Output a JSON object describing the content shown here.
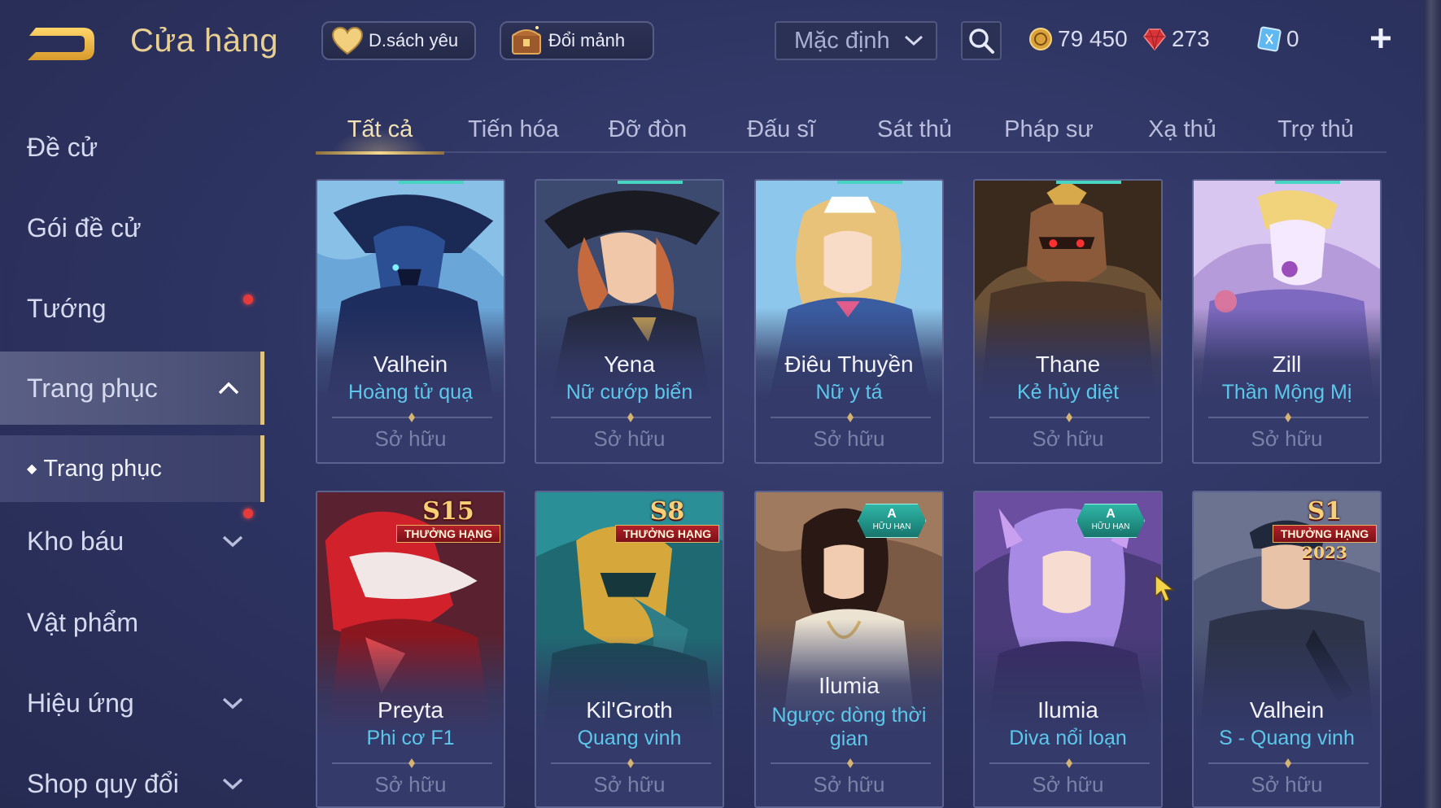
{
  "header": {
    "title": "Cửa hàng",
    "favorites_label": "D.sách yêu",
    "shards_label": "Đổi mảnh",
    "sort_value": "Mặc định",
    "currencies": {
      "gold": "79 450",
      "ruby": "273",
      "voucher": "0"
    },
    "colors": {
      "gold_title": "#e8cf94",
      "accent": "#e2c27a",
      "skin_name": "#5cc7ea"
    }
  },
  "sidebar": {
    "items": [
      {
        "label": "Đề cử"
      },
      {
        "label": "Gói đề cử"
      },
      {
        "label": "Tướng"
      },
      {
        "label": "Trang phục"
      },
      {
        "label": "Kho báu"
      },
      {
        "label": "Vật phẩm"
      },
      {
        "label": "Hiệu ứng"
      },
      {
        "label": "Shop quy đổi"
      }
    ],
    "sub_item": "Trang phục",
    "active": "Trang phục"
  },
  "tabs": [
    "Tất cả",
    "Tiến hóa",
    "Đỡ đòn",
    "Đấu sĩ",
    "Sát thủ",
    "Pháp sư",
    "Xạ thủ",
    "Trợ thủ"
  ],
  "active_tab": "Tất cả",
  "cards": [
    {
      "hero": "Valhein",
      "skin": "Hoàng tử quạ",
      "status": "Sở hữu",
      "badge": null,
      "art": "crow-prince"
    },
    {
      "hero": "Yena",
      "skin": "Nữ cướp biển",
      "status": "Sở hữu",
      "badge": null,
      "art": "pirate"
    },
    {
      "hero": "Điêu Thuyền",
      "skin": "Nữ y tá",
      "status": "Sở hữu",
      "badge": null,
      "art": "nurse"
    },
    {
      "hero": "Thane",
      "skin": "Kẻ hủy diệt",
      "status": "Sở hữu",
      "badge": null,
      "art": "terminator"
    },
    {
      "hero": "Zill",
      "skin": "Thần Mộng Mị",
      "status": "Sở hữu",
      "badge": null,
      "art": "dream"
    },
    {
      "hero": "Preyta",
      "skin": "Phi cơ F1",
      "status": "Sở hữu",
      "badge": {
        "season": "S15",
        "ribbon": "THƯỞNG HẠNG"
      },
      "art": "f1"
    },
    {
      "hero": "Kil'Groth",
      "skin": "Quang vinh",
      "status": "Sở hữu",
      "badge": {
        "season": "S8",
        "ribbon": "THƯỞNG HẠNG"
      },
      "art": "glory"
    },
    {
      "hero": "Ilumia",
      "skin": "Ngược dòng thời gian",
      "status": "Sở hữu",
      "limited": {
        "rank": "A",
        "label": "HỮU HẠN"
      },
      "art": "time"
    },
    {
      "hero": "Ilumia",
      "skin": "Diva nổi loạn",
      "status": "Sở hữu",
      "limited": {
        "rank": "A",
        "label": "HỮU HẠN"
      },
      "art": "diva"
    },
    {
      "hero": "Valhein",
      "skin": "S - Quang vinh",
      "status": "Sở hữu",
      "badge": {
        "season": "S1",
        "ribbon": "THƯỞNG HẠNG",
        "year": "2023"
      },
      "art": "glory2"
    }
  ]
}
